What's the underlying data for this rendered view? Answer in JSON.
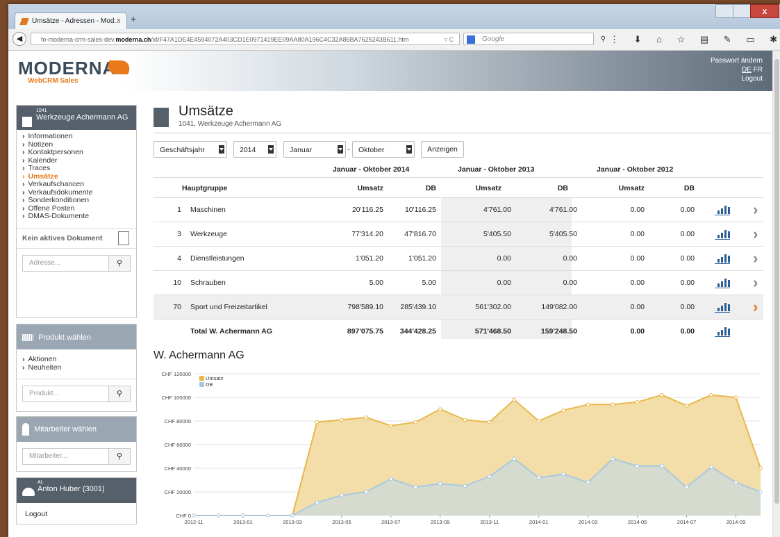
{
  "browser": {
    "tab_title": "Umsätze - Adressen - Mod...",
    "tab_close": "×",
    "new_tab": "+",
    "url_pre": "fo-moderna-crm-sales-dev.",
    "url_domain": "moderna.ch",
    "url_path": "/id/F47A1DE4E4594072A403CD1E0971419EE09AA80A196C4C32A86BA7625243B611.htm",
    "search_placeholder": "Google",
    "reload": "▿ C"
  },
  "header": {
    "logo": "MODERNA",
    "logo_sub": "WebCRM Sales",
    "change_password": "Passwort ändern",
    "lang_de": "DE",
    "lang_fr": "FR",
    "logout": "Logout"
  },
  "sidebar": {
    "company_number": "1041",
    "company_name": "Werkzeuge Achermann AG",
    "menu": [
      "Informationen",
      "Notizen",
      "Kontaktpersonen",
      "Kalender",
      "Traces",
      "Umsätze",
      "Verkaufschancen",
      "Verkaufsdokumente",
      "Sonderkonditionen",
      "Offene Posten",
      "DMAS-Dokumente"
    ],
    "active_index": 5,
    "no_document": "Kein aktives Dokument",
    "address_placeholder": "Adresse...",
    "product_header": "Produkt wählen",
    "product_links": [
      "Aktionen",
      "Neuheiten"
    ],
    "product_placeholder": "Produkt...",
    "employee_header": "Mitarbeiter wählen",
    "employee_placeholder": "Mitarbeiter...",
    "user_initials": "AL",
    "user_name": "Anton Huber (3001)",
    "logout": "Logout"
  },
  "main": {
    "title": "Umsätze",
    "subtitle": "1041, Werkzeuge Achermann AG",
    "filter": {
      "period_type": "Geschäftsjahr",
      "year": "2014",
      "from": "Januar",
      "dash": "-",
      "to": "Oktober",
      "show": "Anzeigen"
    },
    "groups": [
      "Januar - Oktober 2014",
      "Januar - Oktober 2013",
      "Januar - Oktober 2012"
    ],
    "columns": [
      "Hauptgruppe",
      "Umsatz",
      "DB",
      "Umsatz",
      "DB",
      "Umsatz",
      "DB"
    ],
    "rows": [
      {
        "nr": "1",
        "name": "Maschinen",
        "v": [
          "20'116.25",
          "10'116.25",
          "4'761.00",
          "4'761.00",
          "0.00",
          "0.00"
        ]
      },
      {
        "nr": "3",
        "name": "Werkzeuge",
        "v": [
          "77'314.20",
          "47'816.70",
          "5'405.50",
          "5'405.50",
          "0.00",
          "0.00"
        ]
      },
      {
        "nr": "4",
        "name": "Dienstleistungen",
        "v": [
          "1'051.20",
          "1'051.20",
          "0.00",
          "0.00",
          "0.00",
          "0.00"
        ]
      },
      {
        "nr": "10",
        "name": "Schrauben",
        "v": [
          "5.00",
          "5.00",
          "0.00",
          "0.00",
          "0.00",
          "0.00"
        ]
      },
      {
        "nr": "70",
        "name": "Sport und Freizeitartikel",
        "v": [
          "798'589.10",
          "285'439.10",
          "561'302.00",
          "149'082.00",
          "0.00",
          "0.00"
        ]
      }
    ],
    "total": {
      "name": "Total W. Achermann AG",
      "v": [
        "897'075.75",
        "344'428.25",
        "571'468.50",
        "159'248.50",
        "0.00",
        "0.00"
      ]
    },
    "chart_title": "W. Achermann AG"
  },
  "chart_data": {
    "type": "area",
    "title": "W. Achermann AG",
    "x": [
      "2012-11",
      "2012-12",
      "2013-01",
      "2013-02",
      "2013-03",
      "2013-04",
      "2013-05",
      "2013-06",
      "2013-07",
      "2013-08",
      "2013-09",
      "2013-10",
      "2013-11",
      "2013-12",
      "2014-01",
      "2014-02",
      "2014-03",
      "2014-04",
      "2014-05",
      "2014-06",
      "2014-07",
      "2014-08",
      "2014-09",
      "2014-10"
    ],
    "xticks": [
      "2012-11",
      "2013-01",
      "2013-03",
      "2013-05",
      "2013-07",
      "2013-09",
      "2013-11",
      "2014-01",
      "2014-03",
      "2014-05",
      "2014-07",
      "2014-09"
    ],
    "yticks": [
      "CHF 0",
      "CHF 20000",
      "CHF 40000",
      "CHF 60000",
      "CHF 80000",
      "CHF 100000",
      "CHF 120000"
    ],
    "ylim": [
      0,
      120000
    ],
    "series": [
      {
        "name": "Umsatz",
        "color": "#e8b84a",
        "values": [
          0,
          0,
          0,
          0,
          0,
          79000,
          81000,
          83000,
          76000,
          79000,
          90000,
          81000,
          79000,
          98000,
          80000,
          89000,
          94000,
          94000,
          96000,
          102000,
          93000,
          102000,
          100000,
          40000
        ]
      },
      {
        "name": "DB",
        "color": "#a8c8e0",
        "values": [
          0,
          0,
          0,
          0,
          0,
          11000,
          17000,
          20000,
          31000,
          24000,
          27000,
          25000,
          33000,
          48000,
          32000,
          35000,
          28000,
          48000,
          42000,
          42000,
          24000,
          41000,
          28000,
          20000
        ]
      }
    ],
    "legend": "top-left",
    "grid": true
  }
}
